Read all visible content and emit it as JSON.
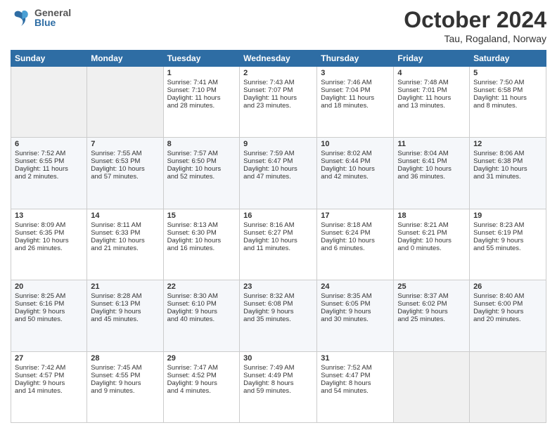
{
  "header": {
    "logo_general": "General",
    "logo_blue": "Blue",
    "month": "October 2024",
    "location": "Tau, Rogaland, Norway"
  },
  "days_of_week": [
    "Sunday",
    "Monday",
    "Tuesday",
    "Wednesday",
    "Thursday",
    "Friday",
    "Saturday"
  ],
  "weeks": [
    [
      {
        "day": "",
        "content": ""
      },
      {
        "day": "",
        "content": ""
      },
      {
        "day": "1",
        "content": "Sunrise: 7:41 AM\nSunset: 7:10 PM\nDaylight: 11 hours\nand 28 minutes."
      },
      {
        "day": "2",
        "content": "Sunrise: 7:43 AM\nSunset: 7:07 PM\nDaylight: 11 hours\nand 23 minutes."
      },
      {
        "day": "3",
        "content": "Sunrise: 7:46 AM\nSunset: 7:04 PM\nDaylight: 11 hours\nand 18 minutes."
      },
      {
        "day": "4",
        "content": "Sunrise: 7:48 AM\nSunset: 7:01 PM\nDaylight: 11 hours\nand 13 minutes."
      },
      {
        "day": "5",
        "content": "Sunrise: 7:50 AM\nSunset: 6:58 PM\nDaylight: 11 hours\nand 8 minutes."
      }
    ],
    [
      {
        "day": "6",
        "content": "Sunrise: 7:52 AM\nSunset: 6:55 PM\nDaylight: 11 hours\nand 2 minutes."
      },
      {
        "day": "7",
        "content": "Sunrise: 7:55 AM\nSunset: 6:53 PM\nDaylight: 10 hours\nand 57 minutes."
      },
      {
        "day": "8",
        "content": "Sunrise: 7:57 AM\nSunset: 6:50 PM\nDaylight: 10 hours\nand 52 minutes."
      },
      {
        "day": "9",
        "content": "Sunrise: 7:59 AM\nSunset: 6:47 PM\nDaylight: 10 hours\nand 47 minutes."
      },
      {
        "day": "10",
        "content": "Sunrise: 8:02 AM\nSunset: 6:44 PM\nDaylight: 10 hours\nand 42 minutes."
      },
      {
        "day": "11",
        "content": "Sunrise: 8:04 AM\nSunset: 6:41 PM\nDaylight: 10 hours\nand 36 minutes."
      },
      {
        "day": "12",
        "content": "Sunrise: 8:06 AM\nSunset: 6:38 PM\nDaylight: 10 hours\nand 31 minutes."
      }
    ],
    [
      {
        "day": "13",
        "content": "Sunrise: 8:09 AM\nSunset: 6:35 PM\nDaylight: 10 hours\nand 26 minutes."
      },
      {
        "day": "14",
        "content": "Sunrise: 8:11 AM\nSunset: 6:33 PM\nDaylight: 10 hours\nand 21 minutes."
      },
      {
        "day": "15",
        "content": "Sunrise: 8:13 AM\nSunset: 6:30 PM\nDaylight: 10 hours\nand 16 minutes."
      },
      {
        "day": "16",
        "content": "Sunrise: 8:16 AM\nSunset: 6:27 PM\nDaylight: 10 hours\nand 11 minutes."
      },
      {
        "day": "17",
        "content": "Sunrise: 8:18 AM\nSunset: 6:24 PM\nDaylight: 10 hours\nand 6 minutes."
      },
      {
        "day": "18",
        "content": "Sunrise: 8:21 AM\nSunset: 6:21 PM\nDaylight: 10 hours\nand 0 minutes."
      },
      {
        "day": "19",
        "content": "Sunrise: 8:23 AM\nSunset: 6:19 PM\nDaylight: 9 hours\nand 55 minutes."
      }
    ],
    [
      {
        "day": "20",
        "content": "Sunrise: 8:25 AM\nSunset: 6:16 PM\nDaylight: 9 hours\nand 50 minutes."
      },
      {
        "day": "21",
        "content": "Sunrise: 8:28 AM\nSunset: 6:13 PM\nDaylight: 9 hours\nand 45 minutes."
      },
      {
        "day": "22",
        "content": "Sunrise: 8:30 AM\nSunset: 6:10 PM\nDaylight: 9 hours\nand 40 minutes."
      },
      {
        "day": "23",
        "content": "Sunrise: 8:32 AM\nSunset: 6:08 PM\nDaylight: 9 hours\nand 35 minutes."
      },
      {
        "day": "24",
        "content": "Sunrise: 8:35 AM\nSunset: 6:05 PM\nDaylight: 9 hours\nand 30 minutes."
      },
      {
        "day": "25",
        "content": "Sunrise: 8:37 AM\nSunset: 6:02 PM\nDaylight: 9 hours\nand 25 minutes."
      },
      {
        "day": "26",
        "content": "Sunrise: 8:40 AM\nSunset: 6:00 PM\nDaylight: 9 hours\nand 20 minutes."
      }
    ],
    [
      {
        "day": "27",
        "content": "Sunrise: 7:42 AM\nSunset: 4:57 PM\nDaylight: 9 hours\nand 14 minutes."
      },
      {
        "day": "28",
        "content": "Sunrise: 7:45 AM\nSunset: 4:55 PM\nDaylight: 9 hours\nand 9 minutes."
      },
      {
        "day": "29",
        "content": "Sunrise: 7:47 AM\nSunset: 4:52 PM\nDaylight: 9 hours\nand 4 minutes."
      },
      {
        "day": "30",
        "content": "Sunrise: 7:49 AM\nSunset: 4:49 PM\nDaylight: 8 hours\nand 59 minutes."
      },
      {
        "day": "31",
        "content": "Sunrise: 7:52 AM\nSunset: 4:47 PM\nDaylight: 8 hours\nand 54 minutes."
      },
      {
        "day": "",
        "content": ""
      },
      {
        "day": "",
        "content": ""
      }
    ]
  ]
}
